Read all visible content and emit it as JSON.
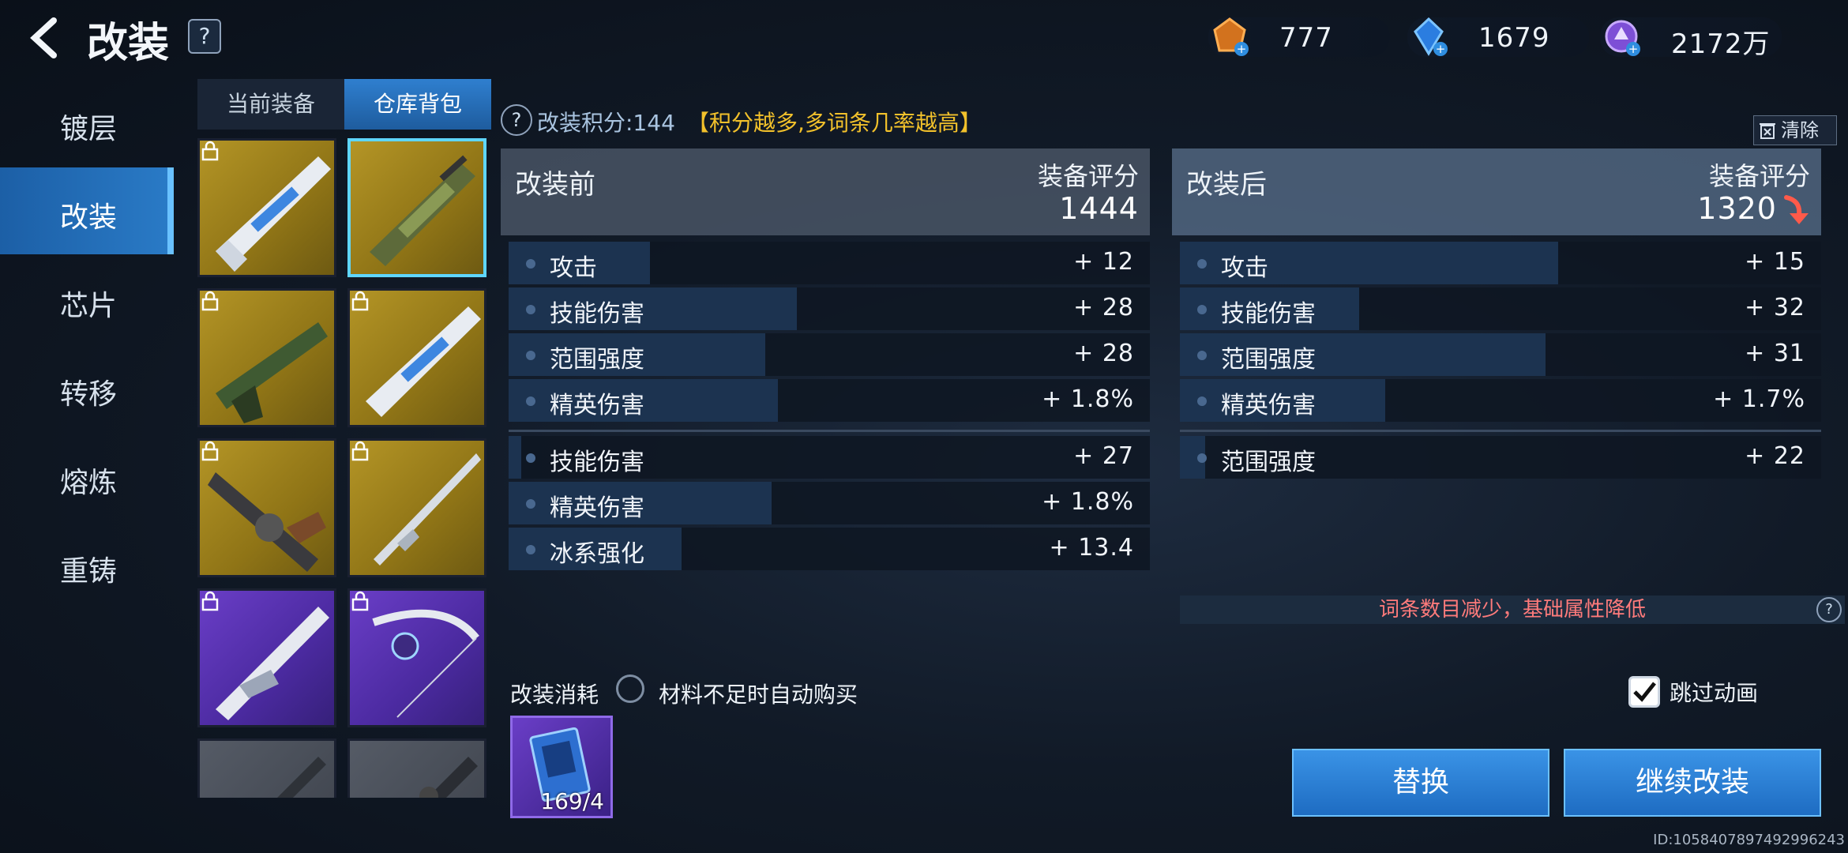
{
  "header": {
    "title": "改装",
    "help_label": "?",
    "currencies": [
      {
        "icon": "orange-crystal-icon",
        "value": "777"
      },
      {
        "icon": "blue-gem-icon",
        "value": "1679"
      },
      {
        "icon": "purple-orb-icon",
        "value": "2172万"
      }
    ]
  },
  "nav": {
    "items": [
      {
        "label": "镀层",
        "active": false
      },
      {
        "label": "改装",
        "active": true
      },
      {
        "label": "芯片",
        "active": false
      },
      {
        "label": "转移",
        "active": false
      },
      {
        "label": "熔炼",
        "active": false
      },
      {
        "label": "重铸",
        "active": false
      }
    ]
  },
  "tabs": [
    {
      "label": "当前装备",
      "active": false
    },
    {
      "label": "仓库背包",
      "active": true
    }
  ],
  "inventory": [
    {
      "rarity": "gold",
      "icon": "white-rifle-icon",
      "locked": true,
      "selected": false
    },
    {
      "rarity": "gold",
      "icon": "green-camo-rifle-icon",
      "locked": false,
      "selected": true
    },
    {
      "rarity": "gold",
      "icon": "green-rifle-icon",
      "locked": true,
      "selected": false
    },
    {
      "rarity": "gold",
      "icon": "white-rifle-icon",
      "locked": true,
      "selected": false
    },
    {
      "rarity": "gold",
      "icon": "shotgun-icon",
      "locked": true,
      "selected": false
    },
    {
      "rarity": "gold",
      "icon": "sniper-rifle-icon",
      "locked": true,
      "selected": false
    },
    {
      "rarity": "purple",
      "icon": "white-rifle-icon",
      "locked": true,
      "selected": false
    },
    {
      "rarity": "purple",
      "icon": "bow-icon",
      "locked": true,
      "selected": false
    },
    {
      "rarity": "grey",
      "icon": "grey-rifle-icon",
      "locked": false,
      "selected": false
    },
    {
      "rarity": "grey",
      "icon": "grey-rifle-icon",
      "locked": false,
      "selected": false
    }
  ],
  "score": {
    "help": "?",
    "label": "改装积分:144",
    "hint": "【积分越多,多词条几率越高】",
    "clear_label": "清除"
  },
  "before": {
    "label": "改装前",
    "score_label": "装备评分",
    "score_value": "1444",
    "stats": [
      {
        "name": "攻击",
        "value": "+ 12",
        "fill": 0.22
      },
      {
        "name": "技能伤害",
        "value": "+ 28",
        "fill": 0.45
      },
      {
        "name": "范围强度",
        "value": "+ 28",
        "fill": 0.4
      },
      {
        "name": "精英伤害",
        "value": "+ 1.8%",
        "fill": 0.42
      }
    ],
    "extra": [
      {
        "name": "技能伤害",
        "value": "+ 27",
        "fill": 0.02
      },
      {
        "name": "精英伤害",
        "value": "+ 1.8%",
        "fill": 0.41
      },
      {
        "name": "冰系强化",
        "value": "+ 13.4",
        "fill": 0.27
      }
    ]
  },
  "after": {
    "label": "改装后",
    "score_label": "装备评分",
    "score_value": "1320",
    "trend": "down",
    "stats": [
      {
        "name": "攻击",
        "value": "+ 15",
        "fill": 0.59
      },
      {
        "name": "技能伤害",
        "value": "+ 32",
        "fill": 0.28
      },
      {
        "name": "范围强度",
        "value": "+ 31",
        "fill": 0.57
      },
      {
        "name": "精英伤害",
        "value": "+ 1.7%",
        "fill": 0.32
      }
    ],
    "extra": [
      {
        "name": "范围强度",
        "value": "+ 22",
        "fill": 0.04
      }
    ],
    "warning": "词条数目减少，基础属性降低",
    "warning_help": "?"
  },
  "cost": {
    "label": "改装消耗",
    "auto_buy_label": "材料不足时自动购买",
    "material_count": "169/4"
  },
  "skip": {
    "label": "跳过动画",
    "checked": true
  },
  "buttons": {
    "replace": "替换",
    "continue": "继续改装"
  },
  "uid": "ID:1058407897492996243",
  "colors": {
    "accent": "#2a7bc7",
    "gold": "#b49526",
    "purple": "#6a3ec7",
    "warning": "#ff7b7b",
    "hint": "#f2c12b"
  }
}
